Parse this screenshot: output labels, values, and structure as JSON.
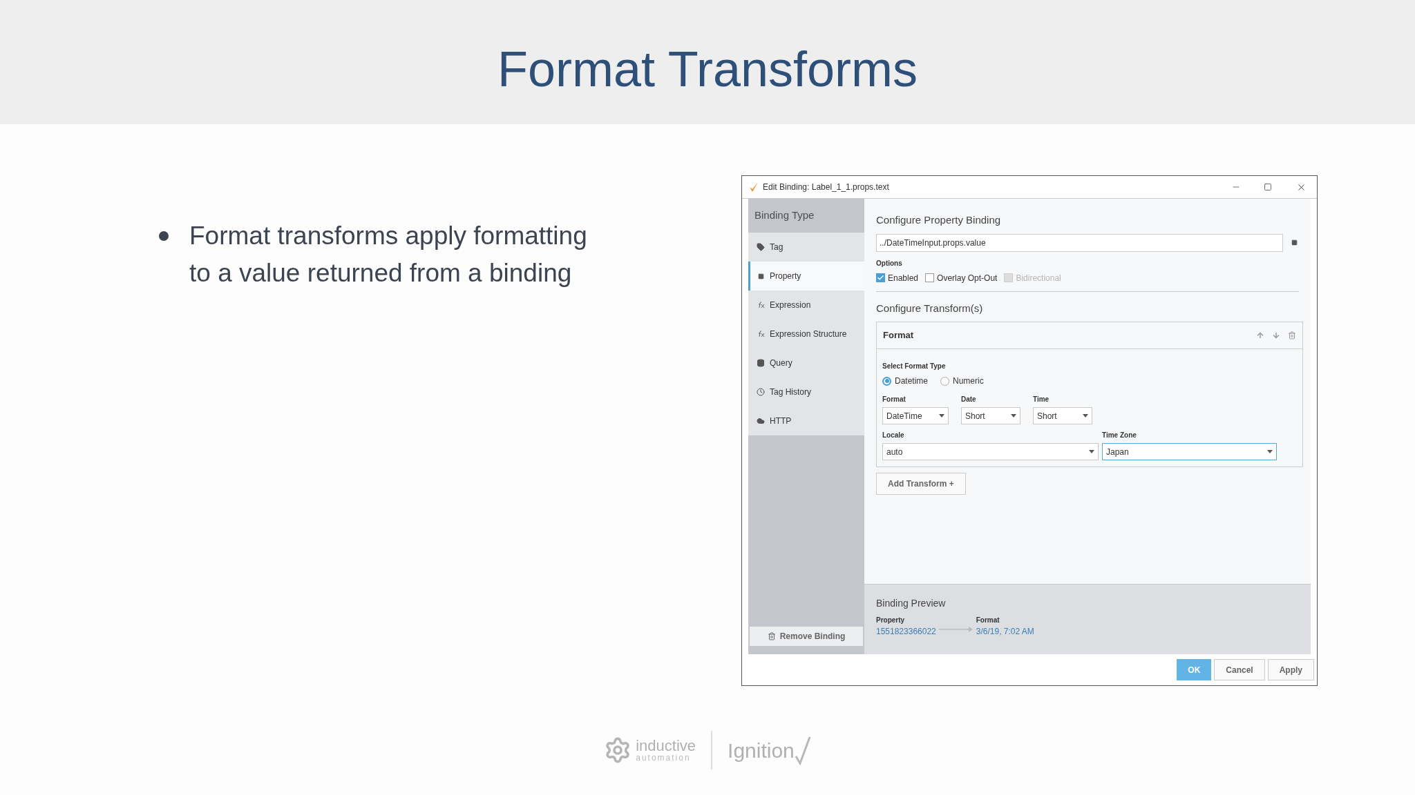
{
  "slide": {
    "title": "Format Transforms",
    "bullets": [
      "Format transforms apply formatting to a value returned from a binding"
    ]
  },
  "dialog": {
    "title": "Edit Binding: Label_1_1.props.text",
    "sidebar": {
      "heading": "Binding Type",
      "items": [
        {
          "label": "Tag",
          "kind": "tag",
          "selected": false
        },
        {
          "label": "Property",
          "kind": "property",
          "selected": true
        },
        {
          "label": "Expression",
          "kind": "expression",
          "selected": false
        },
        {
          "label": "Expression Structure",
          "kind": "expression",
          "selected": false
        },
        {
          "label": "Query",
          "kind": "query",
          "selected": false
        },
        {
          "label": "Tag History",
          "kind": "history",
          "selected": false
        },
        {
          "label": "HTTP",
          "kind": "http",
          "selected": false
        }
      ],
      "remove_button": "Remove Binding"
    },
    "property": {
      "heading": "Configure Property Binding",
      "path": "../DateTimeInput.props.value",
      "options_label": "Options",
      "options": [
        {
          "label": "Enabled",
          "checked": true,
          "disabled": false
        },
        {
          "label": "Overlay Opt-Out",
          "checked": false,
          "disabled": false
        },
        {
          "label": "Bidirectional",
          "checked": false,
          "disabled": true
        }
      ]
    },
    "transforms": {
      "heading": "Configure Transform(s)",
      "card": {
        "title": "Format",
        "type_label": "Select Format Type",
        "types": [
          {
            "label": "Datetime",
            "selected": true
          },
          {
            "label": "Numeric",
            "selected": false
          }
        ],
        "row1": [
          {
            "label": "Format",
            "value": "DateTime"
          },
          {
            "label": "Date",
            "value": "Short"
          },
          {
            "label": "Time",
            "value": "Short"
          }
        ],
        "row2": [
          {
            "label": "Locale",
            "value": "auto",
            "focused": false
          },
          {
            "label": "Time Zone",
            "value": "Japan",
            "focused": true
          }
        ]
      },
      "add_button": "Add Transform +"
    },
    "preview": {
      "heading": "Binding Preview",
      "from_label": "Property",
      "from_value": "1551823366022",
      "to_label": "Format",
      "to_value": "3/6/19, 7:02 AM"
    },
    "buttons": [
      {
        "label": "OK",
        "primary": true
      },
      {
        "label": "Cancel",
        "primary": false
      },
      {
        "label": "Apply",
        "primary": false
      }
    ]
  },
  "footer": {
    "logo1_top": "inductive",
    "logo1_bottom": "automation",
    "logo2": "Ignition"
  }
}
